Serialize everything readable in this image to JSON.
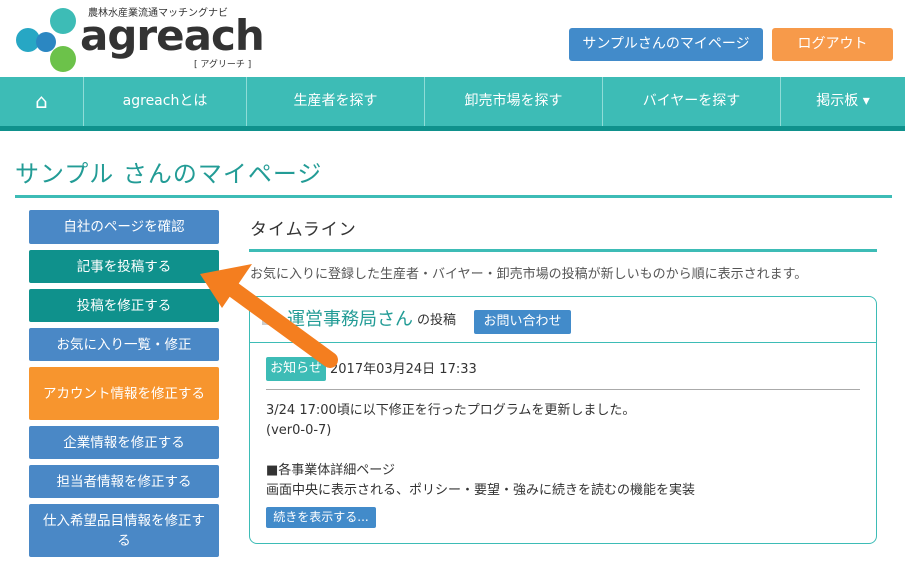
{
  "header": {
    "logo_tagline": "農林水産業流通マッチングナビ",
    "logo_text": "agreach",
    "logo_sub": "[ アグリーチ ]",
    "mypage_button": "サンプルさんのマイページ",
    "logout_button": "ログアウト"
  },
  "nav": {
    "items": [
      {
        "label": "⌂",
        "icon": "home-icon"
      },
      {
        "label": "agreachとは"
      },
      {
        "label": "生産者を探す"
      },
      {
        "label": "卸売市場を探す"
      },
      {
        "label": "バイヤーを探す"
      },
      {
        "label": "掲示板 ▾"
      }
    ]
  },
  "page": {
    "title": "サンプル さんのマイページ"
  },
  "side_menu": [
    {
      "label": "自社のページを確認"
    },
    {
      "label": "記事を投稿する"
    },
    {
      "label": "投稿を修正する"
    },
    {
      "label": "お気に入り一覧・修正"
    },
    {
      "label": "アカウント情報を修正する"
    },
    {
      "label": "企業情報を修正する"
    },
    {
      "label": "担当者情報を修正する"
    },
    {
      "label": "仕入希望品目情報を修正する"
    }
  ],
  "timeline": {
    "title": "タイムライン",
    "description": "お気に入りに登録した生産者・バイヤー・卸売市場の投稿が新しいものから順に表示されます。",
    "post": {
      "poster_name": "運営事務局さん",
      "poster_suffix": "の投稿",
      "contact_button": "お問い合わせ",
      "badge": "お知らせ",
      "date": "2017年03月24日 17:33",
      "body_lines": [
        "3/24 17:00頃に以下修正を行ったプログラムを更新しました。",
        "(ver0-0-7)",
        "",
        "■各事業体詳細ページ",
        "画面中央に表示される、ポリシー・要望・強みに続きを読むの機能を実装"
      ],
      "more_button": "続きを表示する..."
    }
  },
  "colors": {
    "teal": "#3dbcb6",
    "teal_dark": "#0f918c",
    "blue": "#4a88c6",
    "orange": "#f7952e",
    "arrow": "#f47e1f"
  }
}
